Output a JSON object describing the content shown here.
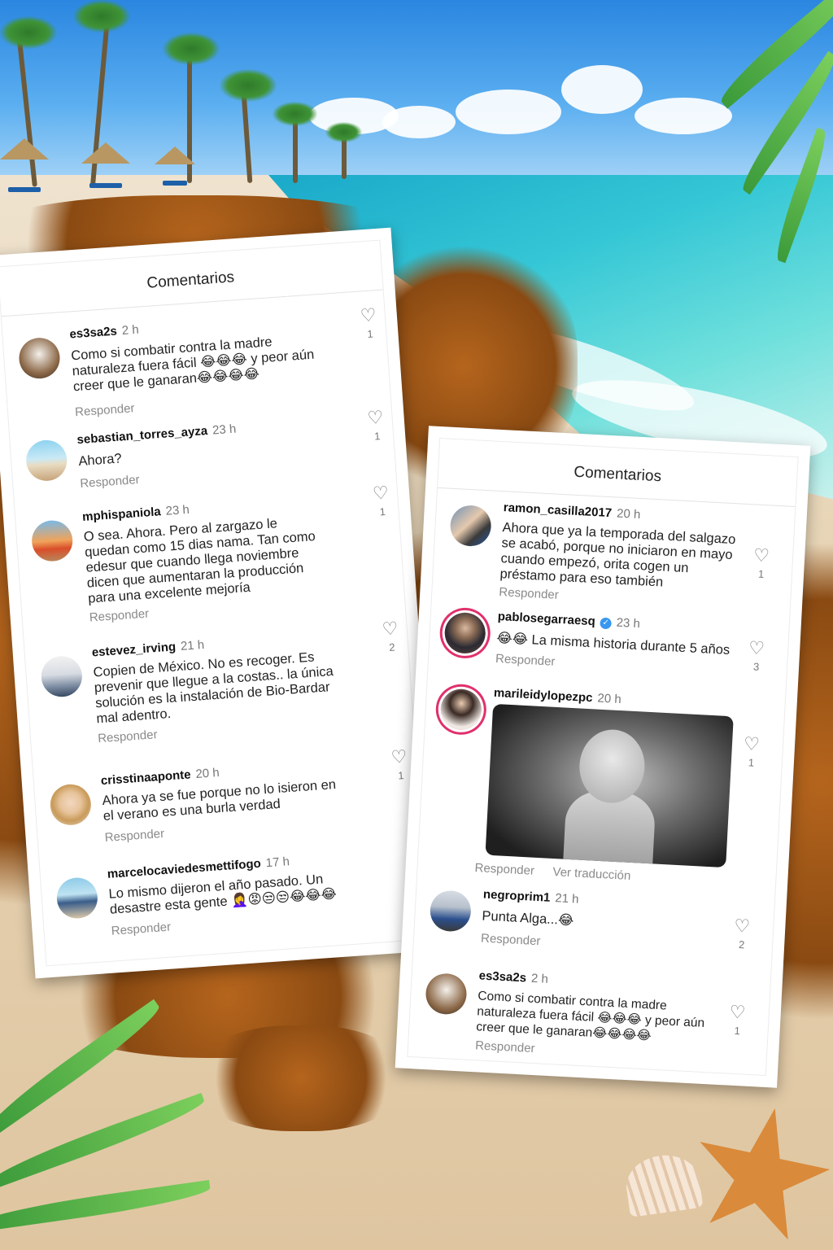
{
  "left_panel": {
    "title": "Comentarios",
    "comments": [
      {
        "user": "es3sa2s",
        "time": "2 h",
        "lines": [
          "Como si combatir contra la madre",
          "naturaleza fuera fácil 😂😂😂 y peor aún",
          "creer que le ganaran😂😂😂😂"
        ],
        "reply": "Responder",
        "likes": "1"
      },
      {
        "user": "sebastian_torres_ayza",
        "time": "23 h",
        "lines": [
          "Ahora?"
        ],
        "reply": "Responder",
        "likes": "1"
      },
      {
        "user": "mphispaniola",
        "time": "23 h",
        "lines": [
          "O sea. Ahora. Pero al zargazo le",
          "quedan como 15 dias nama. Tan como",
          "edesur que cuando llega noviembre",
          "dicen que aumentaran la producción",
          "para una excelente mejoría"
        ],
        "reply": "Responder",
        "likes": "1"
      },
      {
        "user": "estevez_irving",
        "time": "21 h",
        "lines": [
          "Copien de México. No es recoger. Es",
          "prevenir que llegue a la costas.. la única",
          "solución es la instalación de Bio-Bardar",
          "mal adentro."
        ],
        "reply": "Responder",
        "likes": "2"
      },
      {
        "user": "crisstinaaponte",
        "time": "20 h",
        "lines": [
          "Ahora ya se fue porque no lo isieron en",
          "el verano es una burla verdad"
        ],
        "reply": "Responder",
        "likes": "1"
      },
      {
        "user": "marcelocaviedesmettifogo",
        "time": "17 h",
        "lines": [
          "Lo mismo dijeron el año pasado. Un",
          "desastre esta gente 🤦‍♀️😡😒😒😂😂😂"
        ],
        "reply": "Responder",
        "likes": ""
      }
    ]
  },
  "right_panel": {
    "title": "Comentarios",
    "comments": [
      {
        "user": "ramon_casilla2017",
        "time": "20 h",
        "lines": [
          "Ahora que ya la temporada del salgazo",
          "se acabó, porque no iniciaron en mayo",
          "cuando empezó, orita cogen un",
          "préstamo para eso también"
        ],
        "reply": "Responder",
        "likes": "1"
      },
      {
        "user": "pablosegarraesq",
        "time": "23 h",
        "verified": true,
        "lines": [
          "😂😂 La misma historia durante 5 años"
        ],
        "reply": "Responder",
        "likes": "3"
      },
      {
        "user": "marileidylopezpc",
        "time": "20 h",
        "image": "black-and-white-photo-of-sad-child",
        "reply": "Responder",
        "translate": "Ver traducción",
        "likes": "1"
      },
      {
        "user": "negroprim1",
        "time": "21 h",
        "lines": [
          "Punta Alga...😂"
        ],
        "reply": "Responder",
        "likes": "2"
      },
      {
        "user": "es3sa2s",
        "time": "2 h",
        "lines": [
          "Como si combatir contra la madre",
          "naturaleza fuera fácil 😂😂😂 y peor aún",
          "creer que le ganaran😂😂😂😂"
        ],
        "reply": "Responder",
        "likes": "1"
      }
    ]
  },
  "icons": {
    "like": "heart-outline-icon",
    "verified": "verified-badge-icon"
  },
  "colors": {
    "story_ring": "#e1306c",
    "verified": "#3897f0",
    "reply_gray": "#8a8a8a"
  }
}
